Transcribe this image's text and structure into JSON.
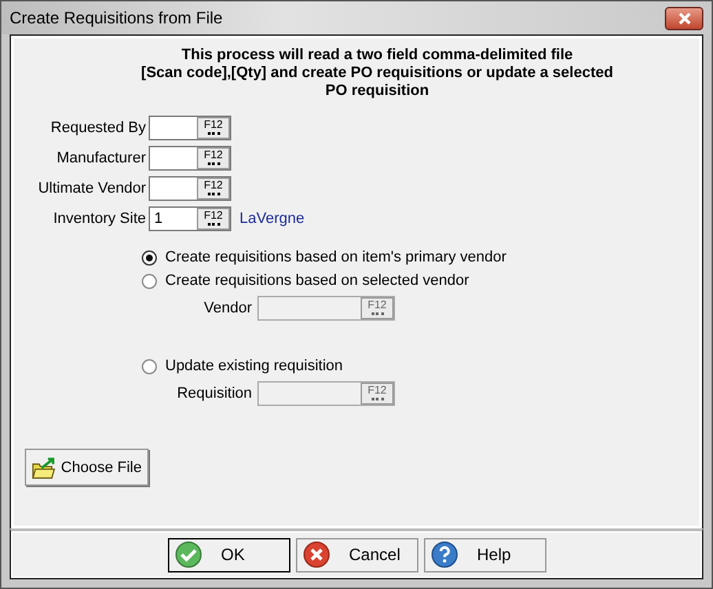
{
  "window": {
    "title": "Create Requisitions from File"
  },
  "intro": [
    "This process will read a two field comma-delimited file",
    "[Scan code],[Qty] and create PO requisitions or update a selected",
    "PO requisition"
  ],
  "fields": [
    {
      "label": "Requested By",
      "lookup": "F12",
      "disabled": false
    },
    {
      "label": "Manufacturer",
      "lookup": "F12",
      "disabled": false
    },
    {
      "label": "Ultimate Vendor",
      "lookup": "F12",
      "disabled": false
    },
    {
      "label": "Inventory Site",
      "value": "1",
      "lookup": "F12",
      "note": "LaVergne",
      "disabled": false
    }
  ],
  "options": [
    {
      "label": "Create requisitions based on item's primary vendor",
      "selected": true
    },
    {
      "label": "Create requisitions based on selected vendor",
      "selected": false,
      "field": {
        "label": "Vendor",
        "lookup": "F12",
        "disabled": true
      }
    },
    {
      "label": "Update existing requisition",
      "selected": false,
      "field": {
        "label": "Requisition",
        "lookup": "F12",
        "disabled": true
      }
    }
  ],
  "choose_file": {
    "label": "Choose File"
  },
  "buttons": [
    {
      "label": "OK",
      "kind": "ok",
      "default": true
    },
    {
      "label": "Cancel",
      "kind": "cancel",
      "default": false
    },
    {
      "label": "Help",
      "kind": "help",
      "default": false
    }
  ]
}
